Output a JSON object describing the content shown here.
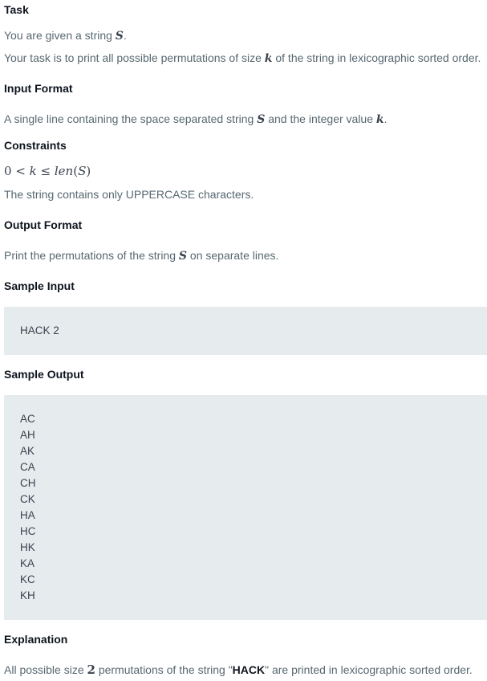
{
  "task": {
    "heading": "Task",
    "line1_pre": "You are given a string ",
    "var_s": "S",
    "line1_post": ".",
    "line2_pre": "Your task is to print all possible permutations of size ",
    "var_k": "k",
    "line2_post": " of the string in lexicographic sorted order."
  },
  "input_format": {
    "heading": "Input Format",
    "text_pre": "A single line containing the space separated string ",
    "var_s": "S",
    "text_mid": " and the integer value ",
    "var_k": "k",
    "text_post": "."
  },
  "constraints": {
    "heading": "Constraints",
    "math_zero": "0",
    "math_lt": " < ",
    "math_k": "k",
    "math_le": " ≤ ",
    "math_len": "len",
    "math_open": "(",
    "math_s": "S",
    "math_close": ")",
    "note": "The string contains only UPPERCASE characters."
  },
  "output_format": {
    "heading": "Output Format",
    "text_pre": "Print the permutations of the string ",
    "var_s": "S",
    "text_post": " on separate lines."
  },
  "sample_input": {
    "heading": "Sample Input",
    "lines": [
      "HACK 2"
    ]
  },
  "sample_output": {
    "heading": "Sample Output",
    "lines": [
      "AC",
      "AH",
      "AK",
      "CA",
      "CH",
      "CK",
      "HA",
      "HC",
      "HK",
      "KA",
      "KC",
      "KH"
    ]
  },
  "explanation": {
    "heading": "Explanation",
    "text_pre": "All possible size ",
    "num": "2",
    "text_mid": " permutations of the string \"",
    "word": "HACK",
    "text_post": "\" are printed in lexicographic sorted order."
  }
}
